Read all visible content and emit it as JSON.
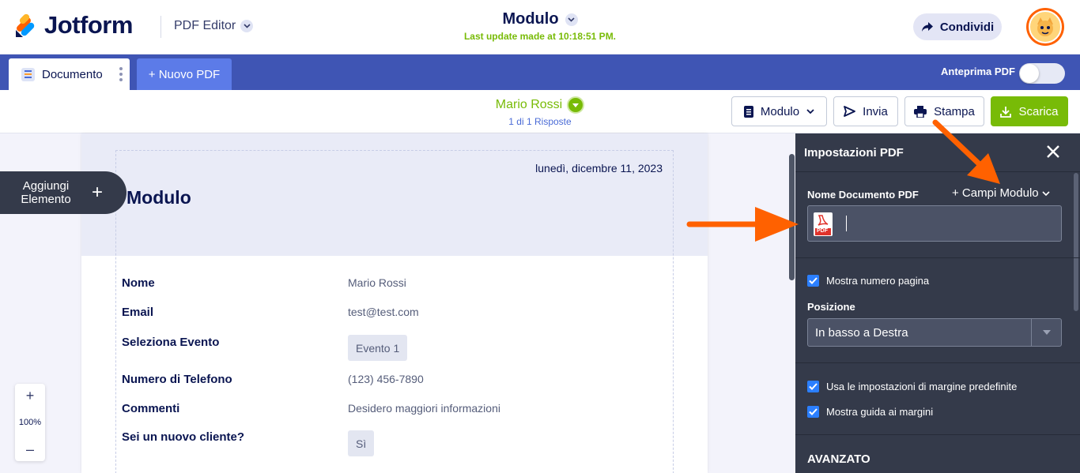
{
  "header": {
    "logo_text": "Jotform",
    "product_label": "PDF Editor",
    "form_title": "Modulo",
    "last_update": "Last update made at 10:18:51 PM.",
    "share_label": "Condividi"
  },
  "tabs": {
    "document_label": "Documento",
    "new_pdf_label": "+ Nuovo PDF",
    "preview_label": "Anteprima PDF"
  },
  "submission": {
    "name": "Mario Rossi",
    "count": "1 di 1 Risposte"
  },
  "toolbar": {
    "form_label": "Modulo",
    "send_label": "Invia",
    "print_label": "Stampa",
    "download_label": "Scarica"
  },
  "document": {
    "date": "lunedì, dicembre 11, 2023",
    "title": "Modulo",
    "fields": [
      {
        "label": "Nome",
        "value": "Mario Rossi"
      },
      {
        "label": "Email",
        "value": "test@test.com"
      },
      {
        "label": "Seleziona Evento",
        "value": "Evento 1"
      },
      {
        "label": "Numero di Telefono",
        "value": "(123) 456-7890"
      },
      {
        "label": "Commenti",
        "value": "Desidero maggiori informazioni"
      },
      {
        "label": "Sei un nuovo cliente?",
        "value": "Sì"
      }
    ]
  },
  "add_element": {
    "label_line1": "Aggiungi",
    "label_line2": "Elemento",
    "plus": "+"
  },
  "zoom": {
    "plus": "+",
    "level": "100%",
    "minus": "–"
  },
  "panel": {
    "title": "Impostazioni PDF",
    "doc_name_label": "Nome Documento PDF",
    "form_fields_label": "+ Campi Modulo",
    "doc_name_value": "",
    "pdf_icon_text": "PDF",
    "show_page_number": "Mostra numero pagina",
    "position_label": "Posizione",
    "position_value": "In basso a Destra",
    "default_margins": "Usa le impostazioni di margine predefinite",
    "show_margin_guide": "Mostra guida ai margini",
    "advanced_label": "AVANZATO"
  },
  "colors": {
    "brand_navy": "#0a1551",
    "tab_blue": "#3f55b4",
    "green": "#78bb07",
    "panel_bg": "#343a4a",
    "annotation_orange": "#ff6100"
  }
}
